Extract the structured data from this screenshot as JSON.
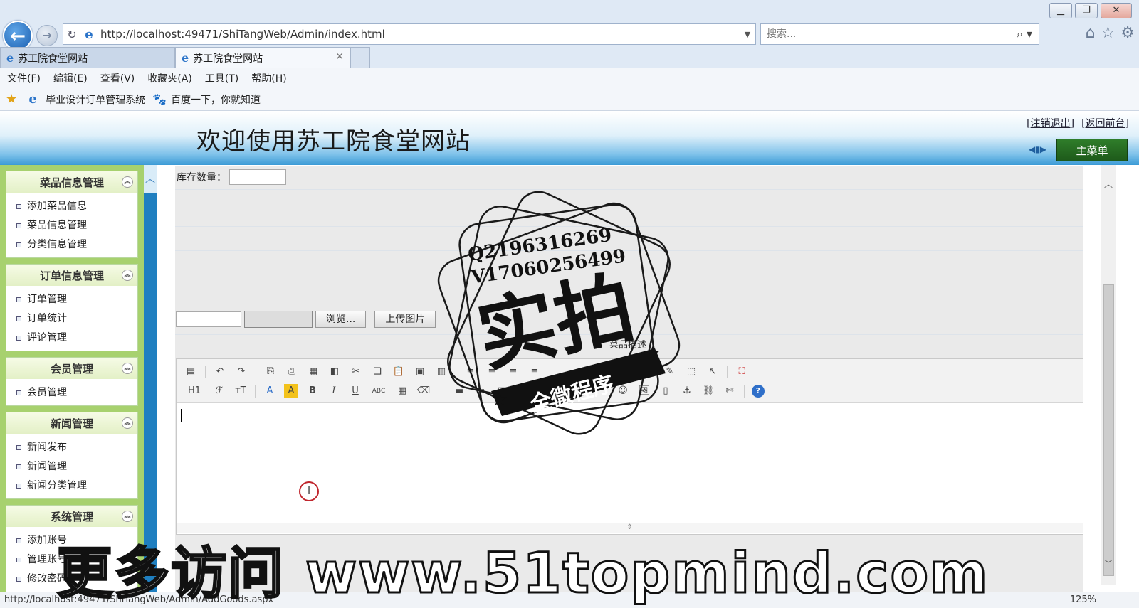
{
  "browser": {
    "url": "http://localhost:49471/ShiTangWeb/Admin/index.html",
    "search_placeholder": "搜索...",
    "tabs": [
      {
        "label": "苏工院食堂网站"
      },
      {
        "label": "苏工院食堂网站"
      }
    ],
    "menu": [
      "文件(F)",
      "编辑(E)",
      "查看(V)",
      "收藏夹(A)",
      "工具(T)",
      "帮助(H)"
    ],
    "favorites": [
      "毕业设计订单管理系统",
      "百度一下，你就知道"
    ]
  },
  "header": {
    "title": "欢迎使用苏工院食堂网站",
    "logout": "注销退出",
    "back_front": "返回前台",
    "main_menu": "主菜单"
  },
  "sidebar": {
    "groups": [
      {
        "title": "菜品信息管理",
        "items": [
          "添加菜品信息",
          "菜品信息管理",
          "分类信息管理"
        ]
      },
      {
        "title": "订单信息管理",
        "items": [
          "订单管理",
          "订单统计",
          "评论管理"
        ]
      },
      {
        "title": "会员管理",
        "items": [
          "会员管理"
        ]
      },
      {
        "title": "新闻管理",
        "items": [
          "新闻发布",
          "新闻管理",
          "新闻分类管理"
        ]
      },
      {
        "title": "系统管理",
        "items": [
          "添加账号",
          "管理账号",
          "修改密码"
        ]
      }
    ]
  },
  "form": {
    "stock_label": "库存数量：",
    "browse_button": "浏览...",
    "upload_button": "上传图片",
    "description_label": "菜品描述"
  },
  "editor_toolbar": {
    "heading": "H1",
    "bold": "B",
    "italic": "I",
    "underline": "U",
    "strikethrough": "ABC"
  },
  "status": {
    "url": "http://localhost:49471/ShiTangWeb/Admin/AddGoods.aspx",
    "zoom": "125%"
  },
  "watermark": {
    "stamp_line1": "Q2196316269",
    "stamp_line2": "V17060256499",
    "stamp_main": "实拍",
    "stamp_banner": "全微程序",
    "bottom_text": "更多访问 www.51topmind.com"
  },
  "colors": {
    "sidebar_green": "#a7d16e",
    "splitter_blue": "#1f7fc0",
    "menu_button_green": "#2f7d2a"
  }
}
